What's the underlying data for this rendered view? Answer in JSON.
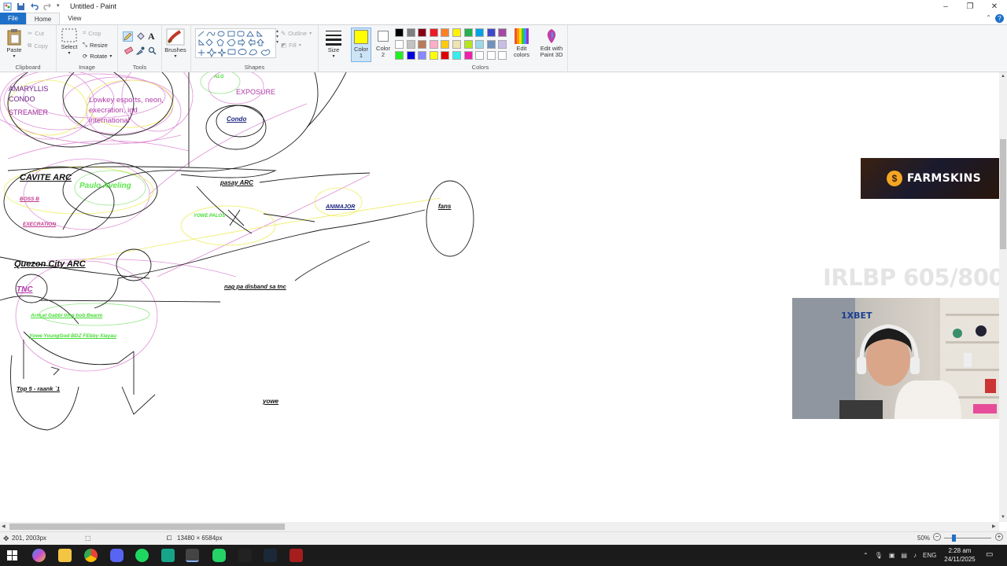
{
  "window": {
    "title": "Untitled - Paint",
    "minimize_glyph": "–",
    "maximize_glyph": "❐",
    "close_glyph": "✕"
  },
  "tabs": [
    "File",
    "Home",
    "View"
  ],
  "ribbon": {
    "clipboard": {
      "group_label": "Clipboard",
      "paste": "Paste",
      "cut": "Cut",
      "copy": "Copy"
    },
    "image": {
      "group_label": "Image",
      "select": "Select",
      "crop": "Crop",
      "resize": "Resize",
      "rotate": "Rotate"
    },
    "tools": {
      "group_label": "Tools",
      "text_glyph": "A"
    },
    "brushes": {
      "label": "Brushes"
    },
    "shapes": {
      "group_label": "Shapes",
      "outline": "Outline",
      "fill": "Fill"
    },
    "size": {
      "label": "Size"
    },
    "color1": {
      "label": "Color",
      "num": "1",
      "value": "#ffff00"
    },
    "color2": {
      "label": "Color",
      "num": "2",
      "value": "#ffffff"
    },
    "colors": {
      "group_label": "Colors",
      "palette_row1": [
        "#000000",
        "#7f7f7f",
        "#880015",
        "#ed1c24",
        "#ff7f27",
        "#fff200",
        "#22b14c",
        "#00a2e8",
        "#3f48cc",
        "#a349a4"
      ],
      "palette_row2": [
        "#ffffff",
        "#c3c3c3",
        "#b97a57",
        "#ffaec9",
        "#ffc90e",
        "#efe4b0",
        "#b5e61d",
        "#99d9ea",
        "#7092be",
        "#c8bfe7"
      ],
      "palette_row3": [
        "#22ee22",
        "#0000dd",
        "#8888ff",
        "#ffff00",
        "#dd0000",
        "#33eeee",
        "#ee22aa",
        "#ffffff",
        "#ffffff",
        "#ffffff"
      ],
      "edit_colors": "Edit colors",
      "edit_paint3d": "Edit with Paint 3D"
    }
  },
  "canvas_text": {
    "amaryllis": "AMARYLLIS",
    "condo_label": "CONDO",
    "streamer": "STREAMER",
    "lowkey": "Lowkey esports, neon,",
    "execration_igd": "execration, igd",
    "international": "international",
    "exposure": "EXPOSURE",
    "condo": "Condo",
    "cavite_arc": "CAVITE ARC",
    "paulo_aveling": "Paulo Aveling",
    "boss_b": "BOSS B",
    "execration": "EXECRATION",
    "pasay_arc": "pasay ARC",
    "animajor": "ANIMAJOR",
    "fans": "fans",
    "quezon_city_arc": "Quezon City ARC",
    "tnc": "TNC",
    "nag_pa_disband": "nag pa disband sa tnc",
    "arms_line": "Arm,el Gabbi tims bob Bearm",
    "yowe_line": "Yowe YoungGod BDZ FEbby Xiayau",
    "top5": "Top 5 - raank `1",
    "yowe": "yowe",
    "yowe_palos": "YOWE PALOS",
    "algo": "ALG"
  },
  "overlays": {
    "farmskins": "FARMSKINS",
    "farmskins_coin": "$",
    "irlbp": "IRLBP 605/800",
    "webcam_brand": "1XBET"
  },
  "statusbar": {
    "cursor": "201, 2003px",
    "dimensions": "13480 × 6584px",
    "zoom": "50%",
    "zoom_level": 0.5
  },
  "taskbar": {
    "language": "ENG",
    "time": "2:28 am",
    "date": "24/11/2025"
  },
  "colors": {
    "accent": "#1e70c8",
    "purple_text": "#7a1f9a",
    "pink_text": "#c0388c",
    "green_text": "#44dd33",
    "navy_text": "#1a237e"
  }
}
